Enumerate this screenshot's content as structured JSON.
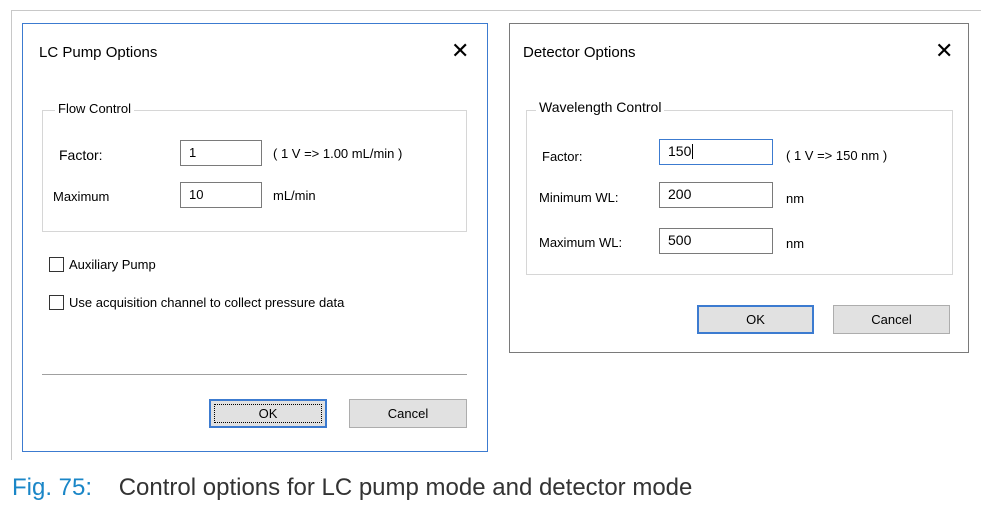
{
  "lc_pump": {
    "title": "LC Pump Options",
    "flow_group": "Flow Control",
    "factor_label": "Factor:",
    "factor_value": "1",
    "factor_hint": "( 1 V => 1.00 mL/min )",
    "maximum_label": "Maximum",
    "maximum_value": "10",
    "maximum_unit": "mL/min",
    "aux_label": "Auxiliary Pump",
    "aux_checked": false,
    "acq_label": "Use acquisition channel to collect pressure data",
    "acq_checked": false,
    "ok_label": "OK",
    "cancel_label": "Cancel"
  },
  "detector": {
    "title": "Detector Options",
    "wl_group": "Wavelength Control",
    "factor_label": "Factor:",
    "factor_value": "150",
    "factor_hint": "( 1 V => 150 nm )",
    "min_label": "Minimum WL:",
    "min_value": "200",
    "min_unit": "nm",
    "max_label": "Maximum WL:",
    "max_value": "500",
    "max_unit": "nm",
    "ok_label": "OK",
    "cancel_label": "Cancel"
  },
  "caption": {
    "number": "Fig. 75:",
    "text": "Control options for LC pump mode and detector mode"
  },
  "icons": {
    "close": "close-icon"
  },
  "colors": {
    "focus_accent": "#3c7bd0",
    "caption_number": "#1a86c7"
  }
}
